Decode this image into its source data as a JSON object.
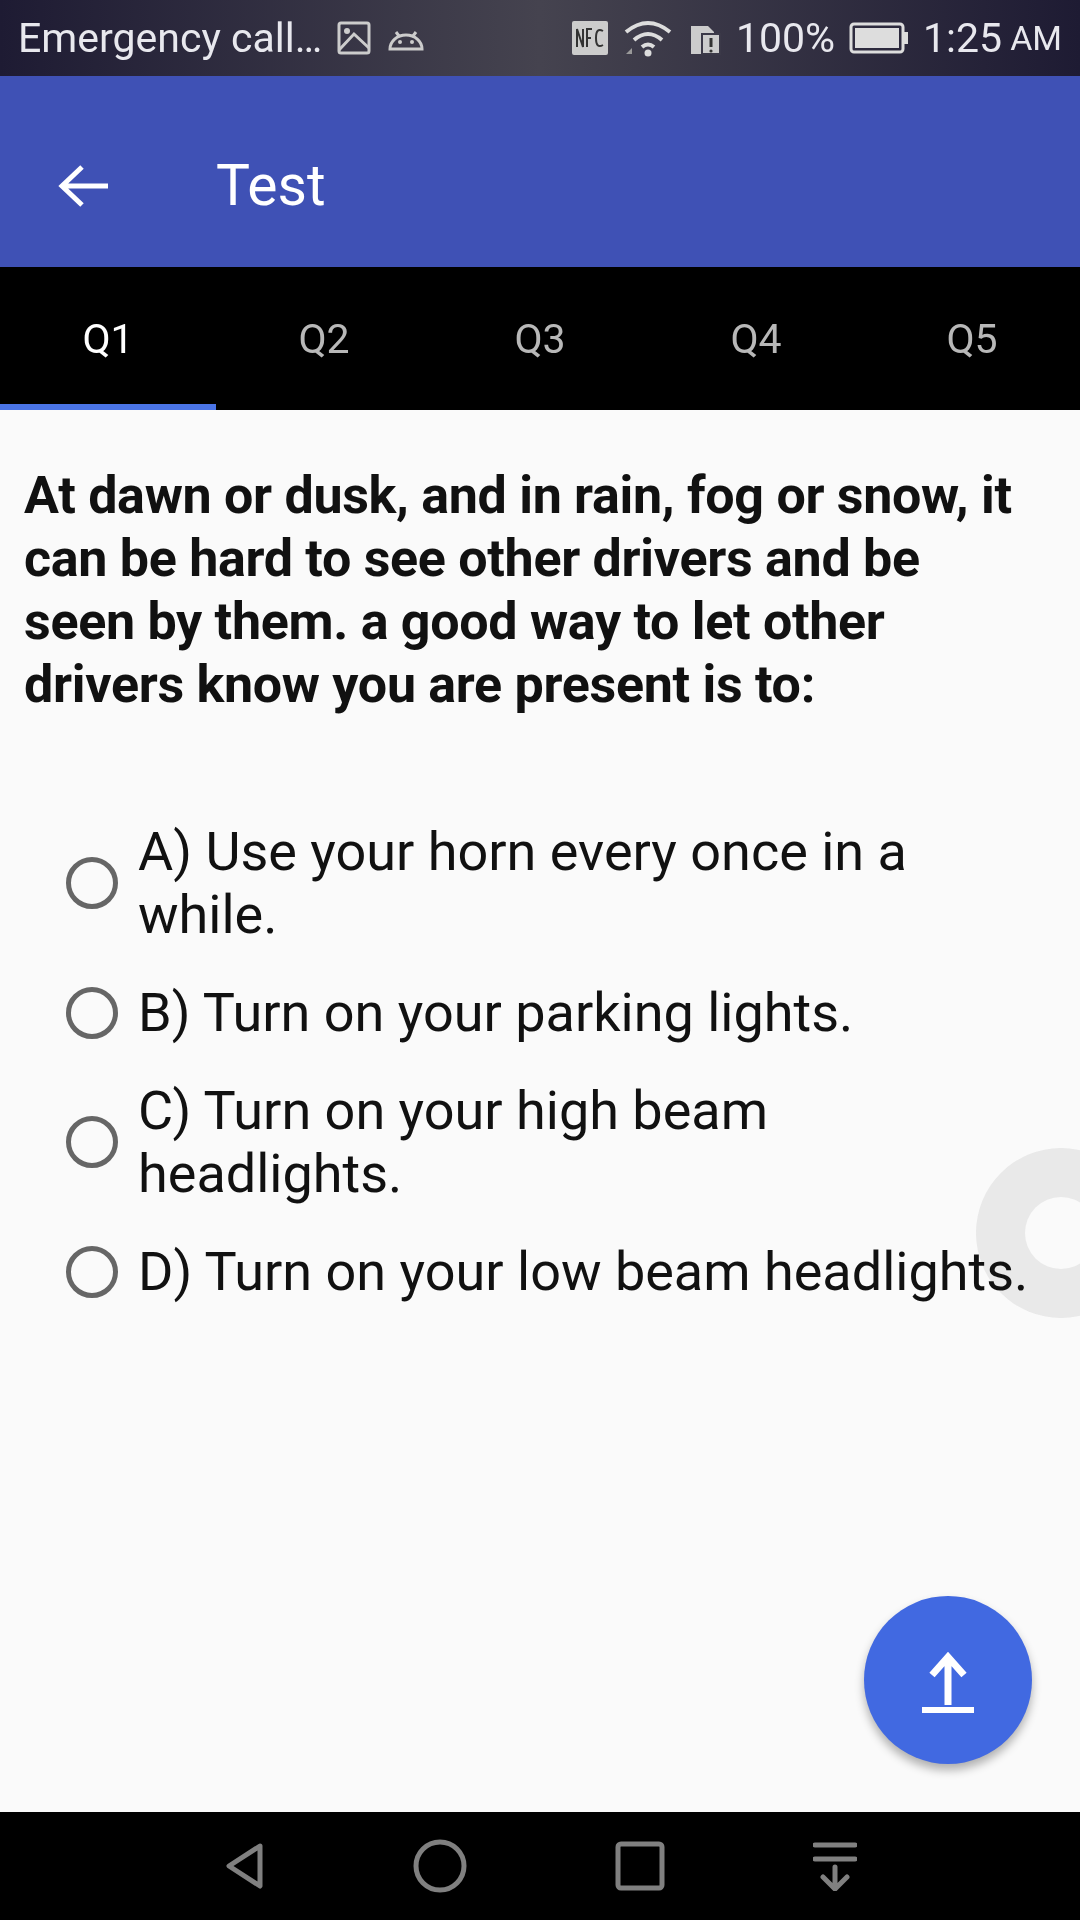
{
  "status_bar": {
    "carrier_text": "Emergency call…",
    "battery": "100%",
    "time": "1:25",
    "meridiem": "AM"
  },
  "app_bar": {
    "title": "Test"
  },
  "tabs": [
    {
      "label": "Q1",
      "selected": true
    },
    {
      "label": "Q2",
      "selected": false
    },
    {
      "label": "Q3",
      "selected": false
    },
    {
      "label": "Q4",
      "selected": false
    },
    {
      "label": "Q5",
      "selected": false
    }
  ],
  "question": "At dawn or dusk, and in rain, fog or snow, it can be hard to see other drivers and be seen by them. a good way to let other drivers know you are present is to:",
  "options": [
    {
      "label": "A) Use your horn every once in a while.",
      "selected": false
    },
    {
      "label": "B) Turn on your parking lights.",
      "selected": false
    },
    {
      "label": "C) Turn on your high beam headlights.",
      "selected": false
    },
    {
      "label": "D) Turn on your low beam headlights.",
      "selected": false
    }
  ]
}
